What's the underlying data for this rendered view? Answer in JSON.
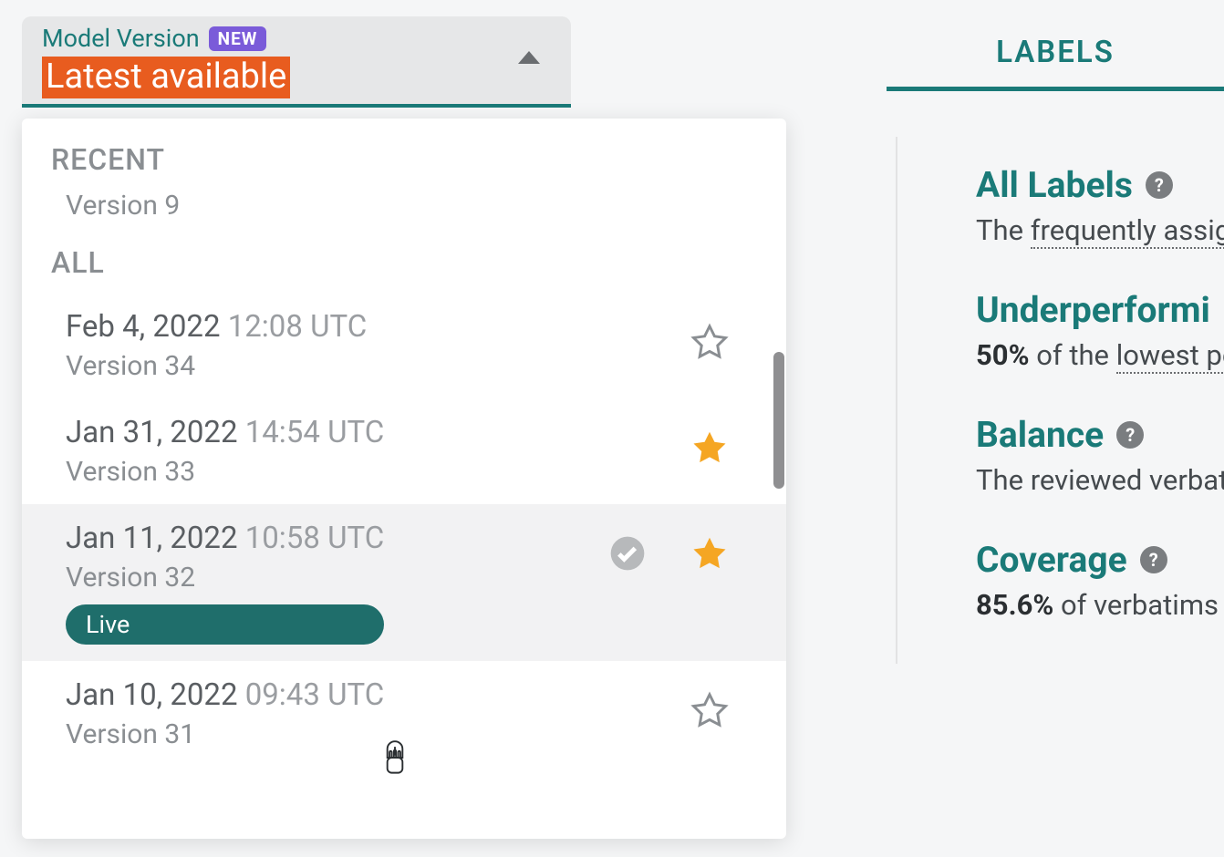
{
  "dropdown": {
    "label": "Model Version",
    "new_badge": "NEW",
    "selected_value": "Latest available"
  },
  "panel": {
    "recent_header": "RECENT",
    "recent_item": "Version 9",
    "all_header": "ALL",
    "items": [
      {
        "date": "Feb 4, 2022",
        "time": "12:08 UTC",
        "version": "Version 34",
        "starred": false,
        "live": false,
        "checked": false
      },
      {
        "date": "Jan 31, 2022",
        "time": "14:54 UTC",
        "version": "Version 33",
        "starred": true,
        "live": false,
        "checked": false
      },
      {
        "date": "Jan 11, 2022",
        "time": "10:58 UTC",
        "version": "Version 32",
        "starred": true,
        "live": true,
        "checked": true
      },
      {
        "date": "Jan 10, 2022",
        "time": "09:43 UTC",
        "version": "Version 31",
        "starred": false,
        "live": false,
        "checked": false
      }
    ],
    "live_chip": "Live"
  },
  "labels": {
    "tab": "LABELS",
    "blocks": [
      {
        "title": "All Labels",
        "desc_prefix": "The ",
        "desc_underlined": "frequently assign",
        "desc_bold": "",
        "desc_rest": ""
      },
      {
        "title": "Underperformi",
        "desc_prefix": "",
        "desc_bold": "50%",
        "desc_mid": " of the ",
        "desc_underlined": "lowest pe",
        "desc_rest": ""
      },
      {
        "title": "Balance",
        "desc_prefix": "The reviewed verbati",
        "desc_bold": "",
        "desc_underlined": "",
        "desc_rest": ""
      },
      {
        "title": "Coverage",
        "desc_prefix": "",
        "desc_bold": "85.6%",
        "desc_mid": " of verbatims a",
        "desc_underlined": "",
        "desc_rest": ""
      }
    ]
  },
  "colors": {
    "accent_teal": "#1a7a78",
    "highlight_orange": "#e85c1f",
    "star_fill": "#f5a623",
    "new_badge_bg": "#7a5bd9",
    "live_chip_bg": "#1f6e6b"
  }
}
